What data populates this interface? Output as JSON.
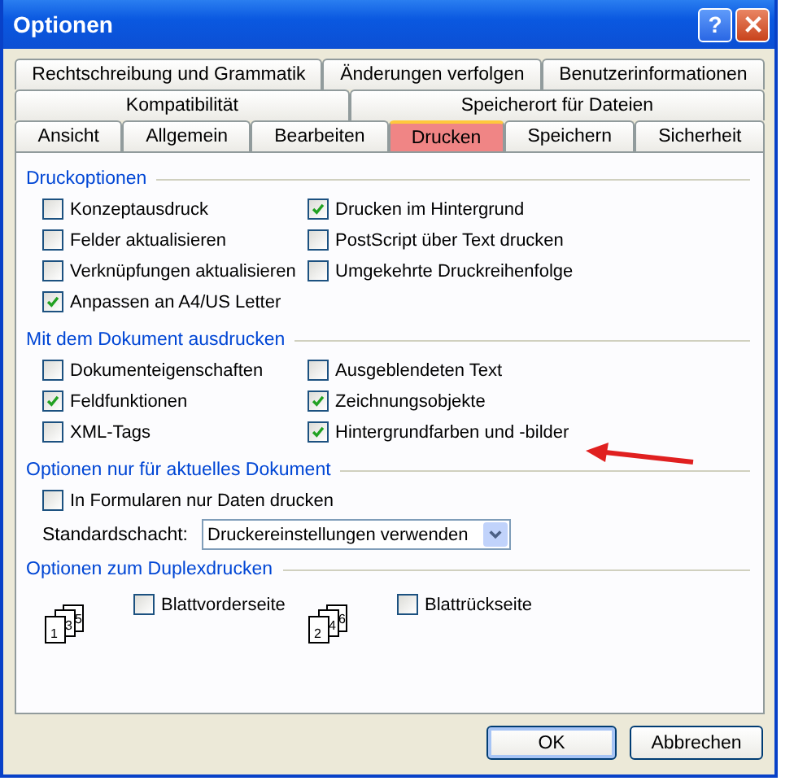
{
  "window": {
    "title": "Optionen",
    "help_label": "?"
  },
  "tab_rows": [
    [
      {
        "label": "Rechtschreibung und Grammatik",
        "selected": false
      },
      {
        "label": "Änderungen verfolgen",
        "selected": false
      },
      {
        "label": "Benutzerinformationen",
        "selected": false
      }
    ],
    [
      {
        "label": "Kompatibilität",
        "selected": false
      },
      {
        "label": "Speicherort für Dateien",
        "selected": false
      }
    ],
    [
      {
        "label": "Ansicht",
        "selected": false
      },
      {
        "label": "Allgemein",
        "selected": false
      },
      {
        "label": "Bearbeiten",
        "selected": false
      },
      {
        "label": "Drucken",
        "selected": true
      },
      {
        "label": "Speichern",
        "selected": false
      },
      {
        "label": "Sicherheit",
        "selected": false
      }
    ]
  ],
  "sections": [
    {
      "title": "Druckoptionen",
      "kind": "grid",
      "columns": [
        [
          {
            "label": "Konzeptausdruck",
            "checked": false
          },
          {
            "label": "Felder aktualisieren",
            "checked": false
          },
          {
            "label": "Verknüpfungen aktualisieren",
            "checked": false
          },
          {
            "label": "Anpassen an A4/US Letter",
            "checked": true
          }
        ],
        [
          {
            "label": "Drucken im Hintergrund",
            "checked": true
          },
          {
            "label": "PostScript über Text drucken",
            "checked": false
          },
          {
            "label": "Umgekehrte Druckreihenfolge",
            "checked": false
          }
        ]
      ]
    },
    {
      "title": "Mit dem Dokument ausdrucken",
      "kind": "grid",
      "columns": [
        [
          {
            "label": "Dokumenteigenschaften",
            "checked": false
          },
          {
            "label": "Feldfunktionen",
            "checked": true
          },
          {
            "label": "XML-Tags",
            "checked": false
          }
        ],
        [
          {
            "label": "Ausgeblendeten Text",
            "checked": false
          },
          {
            "label": "Zeichnungsobjekte",
            "checked": true
          },
          {
            "label": "Hintergrundfarben und -bilder",
            "checked": true
          }
        ]
      ]
    },
    {
      "title": "Optionen nur für aktuelles Dokument",
      "kind": "document",
      "checkbox": {
        "label": "In Formularen nur Daten drucken",
        "checked": false
      },
      "dropdown": {
        "label": "Standardschacht:",
        "value": "Druckereinstellungen verwenden"
      }
    },
    {
      "title": "Optionen zum Duplexdrucken",
      "kind": "duplex",
      "items": [
        {
          "label": "Blattvorderseite",
          "checked": false,
          "pages": [
            "1",
            "3",
            "5"
          ]
        },
        {
          "label": "Blattrückseite",
          "checked": false,
          "pages": [
            "2",
            "4",
            "6"
          ]
        }
      ]
    }
  ],
  "buttons": [
    {
      "label": "OK",
      "default": true
    },
    {
      "label": "Abbrechen",
      "default": false
    }
  ]
}
